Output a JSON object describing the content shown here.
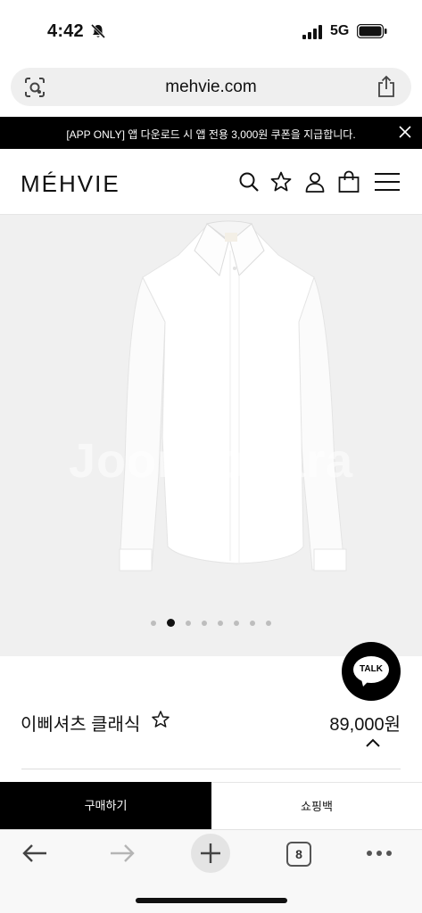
{
  "status_bar": {
    "time": "4:42",
    "network": "5G"
  },
  "browser": {
    "url": "mehvie.com",
    "tab_count": "8"
  },
  "promo": {
    "text": "[APP ONLY] 앱 다운로드 시 앱 전용 3,000원 쿠폰을 지급합니다."
  },
  "header": {
    "logo": "MÉHVIE",
    "icons": [
      "search-icon",
      "star-icon",
      "user-icon",
      "bag-icon",
      "menu-icon"
    ]
  },
  "gallery": {
    "watermark": "Joongonara",
    "slide_count": 8,
    "active_index": 1
  },
  "talk": {
    "label": "TALK"
  },
  "product": {
    "name": "이삐셔츠 클래식",
    "price": "89,000원"
  },
  "actions": {
    "buy_label": "구매하기",
    "cart_label": "쇼핑백"
  },
  "colors": {
    "brand": "#000000",
    "background": "#ffffff",
    "image_bg": "#f0f0f0"
  }
}
